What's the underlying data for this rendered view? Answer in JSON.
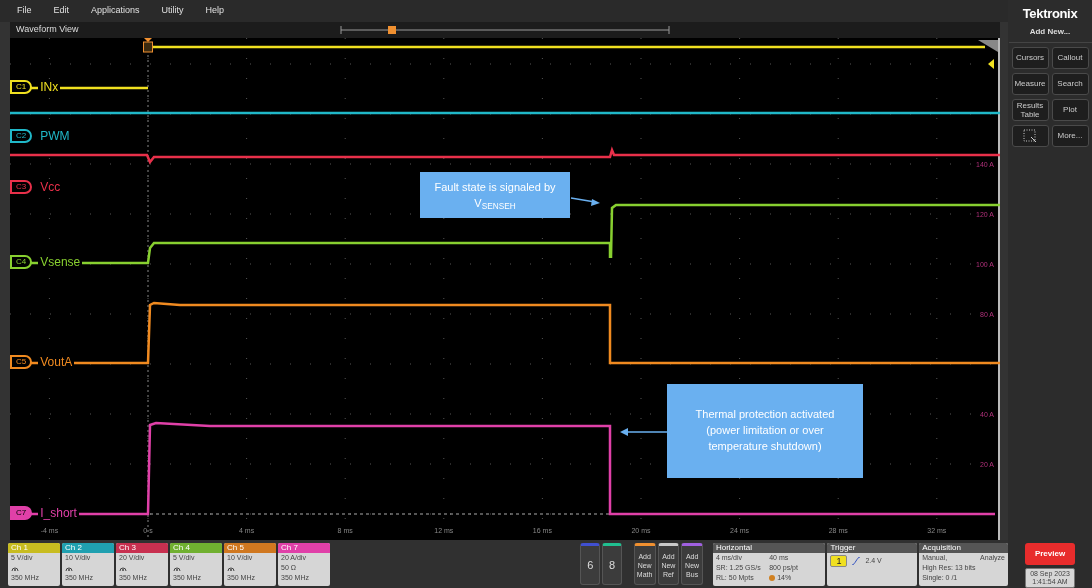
{
  "menu": [
    "File",
    "Edit",
    "Applications",
    "Utility",
    "Help"
  ],
  "waveform_view": {
    "title": "Waveform View",
    "channels": [
      {
        "tag": "C1",
        "name": "INx",
        "color": "#f0e020"
      },
      {
        "tag": "C2",
        "name": "PWM",
        "color": "#20b8c8"
      },
      {
        "tag": "C3",
        "name": "Vcc",
        "color": "#e8304a"
      },
      {
        "tag": "C4",
        "name": "Vsense",
        "color": "#88d030"
      },
      {
        "tag": "C5",
        "name": "VoutA",
        "color": "#f08a20"
      },
      {
        "tag": "C7",
        "name": "I_short",
        "color": "#e040a8"
      }
    ],
    "x_ticks": [
      "-4 ms",
      "0 s",
      "4 ms",
      "8 ms",
      "12 ms",
      "16 ms",
      "20 ms",
      "24 ms",
      "28 ms",
      "32 ms"
    ],
    "y_ticks": [
      "140 A",
      "120 A",
      "100 A",
      "80 A",
      "40 A",
      "20 A"
    ],
    "callouts": [
      {
        "text": "Fault state is signaled by V$_{SENSEH}$"
      },
      {
        "text": "Thermal protection activated (power limitation or over temperature shutdown)"
      }
    ]
  },
  "side_panel": {
    "logo": "Tektronix",
    "heading": "Add New...",
    "buttons": [
      {
        "label": "Cursors"
      },
      {
        "label": "Callout"
      },
      {
        "label": "Measure"
      },
      {
        "label": "Search"
      },
      {
        "label": "Results Table"
      },
      {
        "label": "Plot"
      },
      {
        "kind": "icon"
      },
      {
        "label": "More..."
      }
    ]
  },
  "channel_badges": [
    {
      "title": "Ch 1",
      "scale": "5 V/div",
      "kind": "probe",
      "bandwidth": "350 MHz",
      "color": "#c8bc20"
    },
    {
      "title": "Ch 2",
      "scale": "10 V/div",
      "kind": "probe",
      "bandwidth": "350 MHz",
      "color": "#20a0b0"
    },
    {
      "title": "Ch 3",
      "scale": "20 V/div",
      "kind": "probe",
      "bandwidth": "350 MHz",
      "color": "#c83050"
    },
    {
      "title": "Ch 4",
      "scale": "5 V/div",
      "kind": "probe",
      "bandwidth": "350 MHz",
      "color": "#70b030"
    },
    {
      "title": "Ch 5",
      "scale": "10 V/div",
      "kind": "probe",
      "bandwidth": "350 MHz",
      "color": "#d07820"
    },
    {
      "title": "Ch 7",
      "scale": "20 A/div",
      "kind": "termination",
      "setting": "50 Ω",
      "bandwidth": "350 MHz",
      "color": "#e040a8"
    }
  ],
  "extra_channels": [
    {
      "label": "6",
      "color": "#4050d0"
    },
    {
      "label": "8",
      "color": "#20c090"
    }
  ],
  "add_buttons": [
    {
      "label": "Add New Math",
      "color": "#f09030"
    },
    {
      "label": "Add New Ref",
      "color": "#c8c8c8"
    },
    {
      "label": "Add New Bus",
      "color": "#a060e0"
    }
  ],
  "horizontal": {
    "title": "Horizontal",
    "rows": [
      [
        "4 ms/div",
        "40 ms"
      ],
      [
        "SR: 1.25 GS/s",
        "800 ps/pt"
      ],
      [
        "RL: 50 Mpts",
        "14%"
      ]
    ]
  },
  "trigger": {
    "title": "Trigger",
    "source": "1",
    "level": "2.4 V"
  },
  "acquisition": {
    "title": "Acquisition",
    "rows": [
      [
        "Manual,",
        "Analyze"
      ],
      [
        "High Res: 13 bits"
      ],
      [
        "Single: 0 /1"
      ]
    ]
  },
  "preview_button": "Preview",
  "clock": {
    "date": "08 Sep 2023",
    "time": "1:41:54 AM"
  }
}
